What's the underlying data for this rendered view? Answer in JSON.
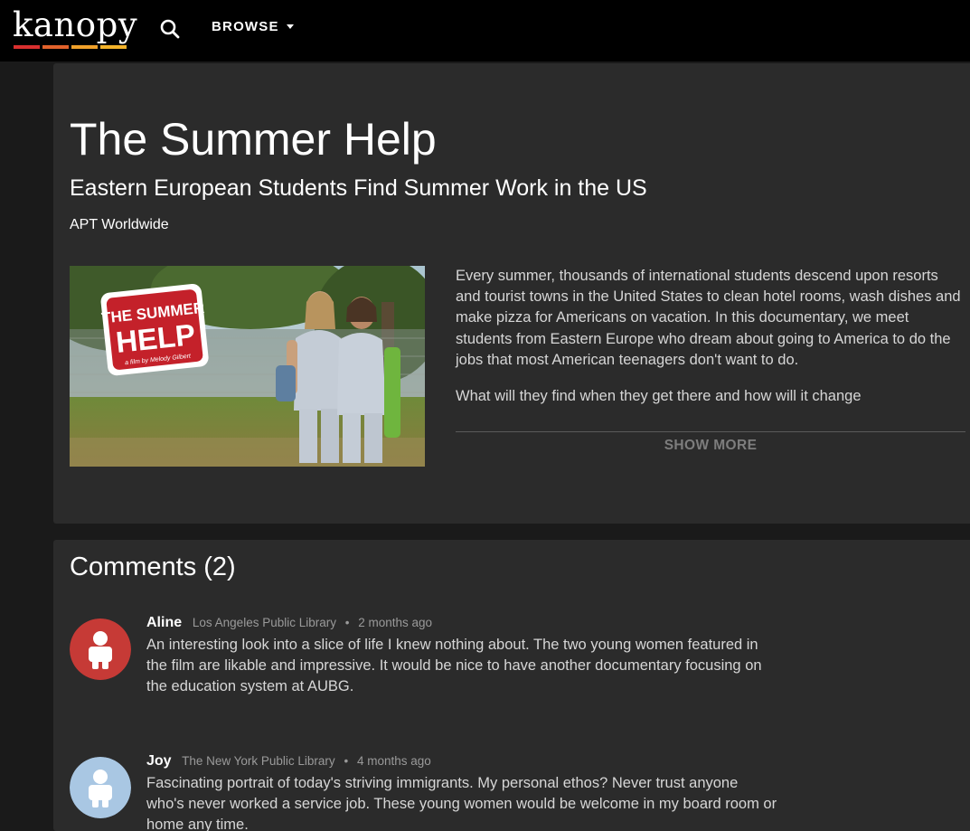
{
  "header": {
    "logo_text": "kanopy",
    "logo_colors": [
      "#d9302f",
      "#e2622b",
      "#f0a02a",
      "#f4b32a"
    ],
    "search_icon": "search-icon",
    "browse_label": "BROWSE",
    "browse_icon": "caret-down-icon"
  },
  "film": {
    "title": "The Summer Help",
    "subtitle": "Eastern European Students Find Summer Work in the US",
    "producer": "APT Worldwide",
    "thumbnail": {
      "sign_line1": "THE SUMMER",
      "sign_line2": "HELP",
      "sign_credit": "a film by Melody Gilbert",
      "sign_color": "#c4212a"
    },
    "description_p1": "Every summer, thousands of international students descend upon resorts and tourist towns in the United States to clean hotel rooms, wash dishes and make pizza for Americans on vacation. In this documentary, we meet students from Eastern Europe who dream about going to America to do the jobs that most American teenagers don't want to do.",
    "description_p2": "What will they find when they get there and how will it change",
    "show_more_label": "SHOW MORE"
  },
  "comments": {
    "title": "Comments (2)",
    "items": [
      {
        "name": "Aline",
        "library": "Los Angeles Public Library",
        "separator": "•",
        "time": "2 months ago",
        "avatar_color": "#c63a36",
        "text": "An interesting look into a slice of life I knew nothing about. The two young women featured in the film are likable and impressive. It would be nice to have another documentary focusing on the education system at AUBG."
      },
      {
        "name": "Joy",
        "library": "The New York Public Library",
        "separator": "•",
        "time": "4 months ago",
        "avatar_color": "#a9c7e3",
        "text": "Fascinating portrait of today's striving immigrants. My personal ethos? Never trust anyone who's never worked a service job. These young women would be welcome in my board room or home any time."
      }
    ]
  }
}
